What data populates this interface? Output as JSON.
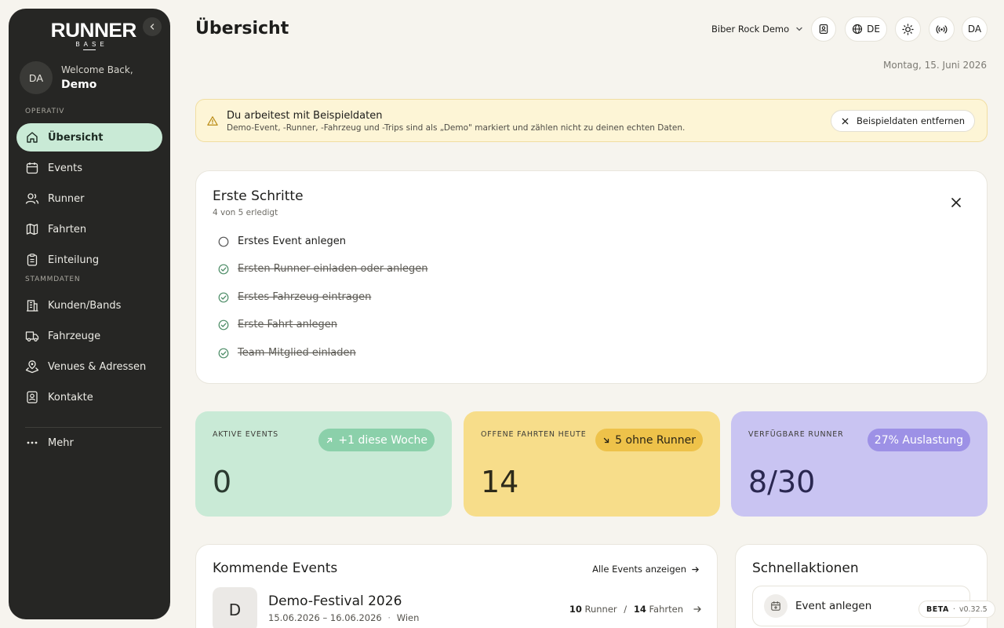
{
  "sidebar": {
    "logo_main": "RUNNER",
    "logo_sub": "BASE",
    "user": {
      "initials": "DA",
      "greeting": "Welcome Back,",
      "name": "Demo"
    },
    "section_operativ": "OPERATIV",
    "section_stammdaten": "STAMMDATEN",
    "nav": {
      "uebersicht": "Übersicht",
      "events": "Events",
      "runner": "Runner",
      "fahrten": "Fahrten",
      "einteilung": "Einteilung",
      "kunden": "Kunden/Bands",
      "fahrzeuge": "Fahrzeuge",
      "venues": "Venues & Adressen",
      "kontakte": "Kontakte",
      "mehr": "Mehr"
    },
    "active_item": "Übersicht"
  },
  "header": {
    "title": "Übersicht",
    "project": "Biber Rock Demo",
    "language": "DE",
    "user_initials": "DA",
    "date": "Montag, 15. Juni 2026"
  },
  "banner": {
    "title": "Du arbeitest mit Beispieldaten",
    "text": "Demo-Event, -Runner, -Fahrzeug und -Trips sind als „Demo\" markiert und zählen nicht zu deinen echten Daten.",
    "button": "Beispieldaten entfernen"
  },
  "steps": {
    "title": "Erste Schritte",
    "progress": "4 von 5 erledigt",
    "items": [
      {
        "label": "Erstes Event anlegen",
        "done": false
      },
      {
        "label": "Ersten Runner einladen oder anlegen",
        "done": true
      },
      {
        "label": "Erstes Fahrzeug eintragen",
        "done": true
      },
      {
        "label": "Erste Fahrt anlegen",
        "done": true
      },
      {
        "label": "Team-Mitglied einladen",
        "done": true
      }
    ]
  },
  "stats": [
    {
      "label": "AKTIVE EVENTS",
      "value": "0",
      "badge": "+1 diese Woche"
    },
    {
      "label": "OFFENE FAHRTEN HEUTE",
      "value": "14",
      "badge": "5 ohne Runner"
    },
    {
      "label": "VERFÜGBARE RUNNER",
      "value": "8/30",
      "badge": "27% Auslastung"
    }
  ],
  "events": {
    "title": "Kommende Events",
    "link": "Alle Events anzeigen",
    "items": [
      {
        "initial": "D",
        "name": "Demo-Festival 2026",
        "dates": "15.06.2026 – 16.06.2026",
        "city": "Wien",
        "runner_count": "10",
        "runner_label": "Runner",
        "separator": "/",
        "trip_count": "14",
        "trip_label": "Fahrten"
      }
    ]
  },
  "quick": {
    "title": "Schnellaktionen",
    "items": [
      {
        "label": "Event anlegen"
      }
    ]
  },
  "footer": {
    "beta": "BETA",
    "separator": "·",
    "version": "v0.32.5"
  },
  "colors": {
    "sidebar_bg": "#262624",
    "accent_green": "#c9ead6",
    "accent_yellow": "#f7dd8a",
    "accent_purple": "#c9c4f2",
    "check_green": "#4c8c66"
  }
}
